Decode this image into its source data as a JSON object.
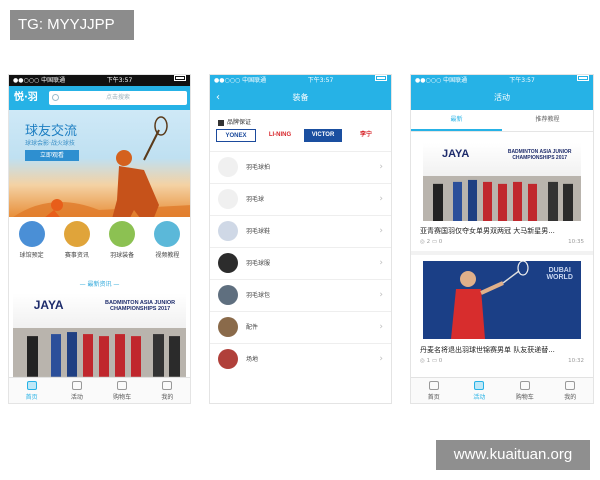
{
  "watermark": {
    "tag": "TG: MYYJJPP",
    "site": "www.kuaituan.org"
  },
  "status": {
    "carrier": "●●○○○ 中国联通 ",
    "time": "下午3:57"
  },
  "screen_home": {
    "logo": "悦·羽",
    "search_placeholder": "点击搜索",
    "banner": {
      "title": "球友交流",
      "subtitle": "球球会影·战火球技",
      "button": "立即观看"
    },
    "categories": [
      {
        "label": "球馆预定",
        "icon": "badminton-court-icon",
        "color": "#4a8fd6"
      },
      {
        "label": "赛事资讯",
        "icon": "trophy-icon",
        "color": "#e0a43a"
      },
      {
        "label": "羽球装备",
        "icon": "shuttlecock-icon",
        "color": "#8cc152"
      },
      {
        "label": "视频教程",
        "icon": "racket-icon",
        "color": "#5bb8d9"
      }
    ],
    "section_title": "— 最新资讯 —",
    "photo": {
      "brand": "JAYA",
      "event": "BADMINTON ASIA JUNIOR CHAMPIONSHIPS 2017"
    }
  },
  "screen_gear": {
    "title": "装备",
    "brand_section": "品牌保证",
    "brands": [
      {
        "name": "YONEX",
        "color": "#1b4a9c",
        "bg": "#ffffff"
      },
      {
        "name": "LI-NING",
        "color": "#d7262b",
        "bg": "#ffffff"
      },
      {
        "name": "VICTOR",
        "color": "#ffffff",
        "bg": "#1a4fa0"
      },
      {
        "name": "李宁",
        "color": "#d7262b",
        "bg": "#ffffff"
      }
    ],
    "items": [
      {
        "label": "羽毛球拍",
        "icon": "racket-icon"
      },
      {
        "label": "羽毛球",
        "icon": "shuttlecock-icon"
      },
      {
        "label": "羽毛球鞋",
        "icon": "shoe-icon"
      },
      {
        "label": "羽毛球服",
        "icon": "shirt-icon"
      },
      {
        "label": "羽毛球包",
        "icon": "bag-icon"
      },
      {
        "label": "配件",
        "icon": "accessory-icon"
      },
      {
        "label": "场地",
        "icon": "court-icon"
      }
    ]
  },
  "screen_activity": {
    "title": "活动",
    "tabs": [
      "最新",
      "推荐教程"
    ],
    "news": [
      {
        "title": "亚青赛国羽仅夺女单男双两冠 大马新星男...",
        "views": "2",
        "comments": "0",
        "time": "10:35",
        "photo": {
          "brand": "JAYA",
          "event": "BADMINTON ASIA JUNIOR CHAMPIONSHIPS 2017"
        }
      },
      {
        "title": "丹麦名将退出羽球世锦赛男单 队友获递替...",
        "views": "1",
        "comments": "0",
        "time": "10:32",
        "photo": {
          "brand": "",
          "event": "DUBAI WORLD"
        }
      }
    ]
  },
  "tabbar": [
    {
      "label": "首页",
      "icon": "home-icon"
    },
    {
      "label": "活动",
      "icon": "activity-icon"
    },
    {
      "label": "购物车",
      "icon": "cart-icon"
    },
    {
      "label": "我的",
      "icon": "profile-icon"
    }
  ]
}
